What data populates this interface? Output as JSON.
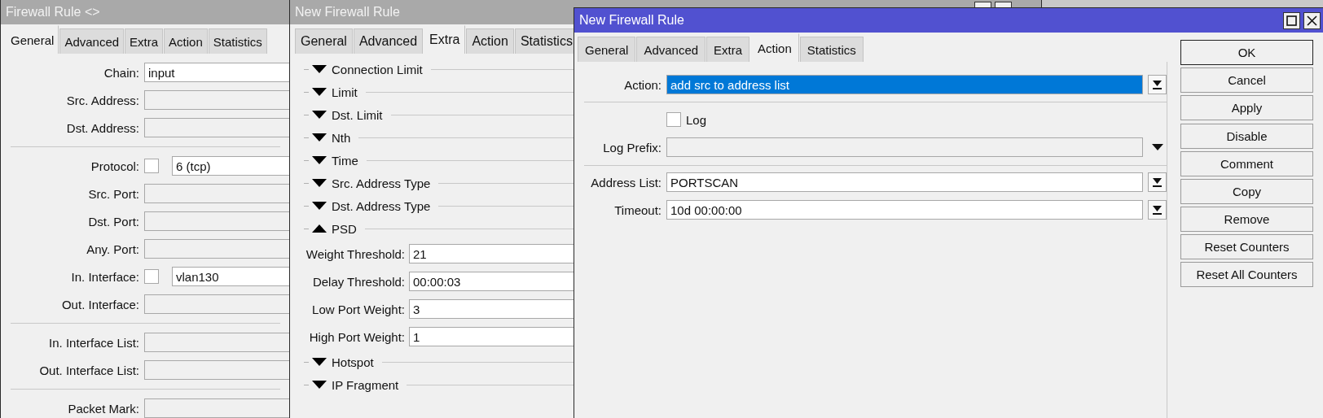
{
  "rule_window": {
    "title": "Firewall Rule <>",
    "active": false,
    "tabs": [
      {
        "label": "General",
        "selected": true
      },
      {
        "label": "Advanced",
        "selected": false
      },
      {
        "label": "Extra",
        "selected": false
      },
      {
        "label": "Action",
        "selected": false
      },
      {
        "label": "Statistics",
        "selected": false
      }
    ],
    "sections": [
      {
        "fields": [
          {
            "kind": "field",
            "label": "Chain:",
            "value": "input"
          },
          {
            "kind": "field",
            "label": "Src. Address:"
          },
          {
            "kind": "field",
            "label": "Dst. Address:"
          }
        ]
      },
      {
        "fields": [
          {
            "kind": "check_field",
            "label": "Protocol:",
            "checked": false,
            "value": "6 (tcp)"
          },
          {
            "kind": "field",
            "label": "Src. Port:"
          },
          {
            "kind": "field",
            "label": "Dst. Port:"
          },
          {
            "kind": "field",
            "label": "Any. Port:"
          },
          {
            "kind": "check_field",
            "label": "In. Interface:",
            "checked": false,
            "value": "vlan130"
          },
          {
            "kind": "field",
            "label": "Out. Interface:"
          }
        ]
      },
      {
        "fields": [
          {
            "kind": "field",
            "label": "In. Interface List:"
          },
          {
            "kind": "field",
            "label": "Out. Interface List:"
          }
        ]
      },
      {
        "fields": [
          {
            "kind": "field",
            "label": "Packet Mark:"
          }
        ]
      }
    ]
  },
  "extra_window": {
    "title": "New Firewall Rule",
    "active": false,
    "tabs": [
      {
        "label": "General",
        "selected": false
      },
      {
        "label": "Advanced",
        "selected": false
      },
      {
        "label": "Extra",
        "selected": true
      },
      {
        "label": "Action",
        "selected": false
      },
      {
        "label": "Statistics",
        "selected": false
      }
    ],
    "sections": [
      {
        "label": "Connection Limit",
        "expanded": false
      },
      {
        "label": "Limit",
        "expanded": false
      },
      {
        "label": "Dst. Limit",
        "expanded": false
      },
      {
        "label": "Nth",
        "expanded": false
      },
      {
        "label": "Time",
        "expanded": false
      },
      {
        "label": "Src. Address Type",
        "expanded": false
      },
      {
        "label": "Dst. Address Type",
        "expanded": false
      },
      {
        "label": "PSD",
        "expanded": true,
        "fields": [
          {
            "label": "Weight Threshold:",
            "value": "21"
          },
          {
            "label": "Delay Threshold:",
            "value": "00:00:03"
          },
          {
            "label": "Low Port Weight:",
            "value": "3"
          },
          {
            "label": "High Port Weight:",
            "value": "1"
          }
        ]
      },
      {
        "label": "Hotspot",
        "expanded": false
      },
      {
        "label": "IP Fragment",
        "expanded": false
      }
    ]
  },
  "action_window": {
    "title": "New Firewall Rule",
    "active": true,
    "tabs": [
      {
        "label": "General",
        "selected": false
      },
      {
        "label": "Advanced",
        "selected": false
      },
      {
        "label": "Extra",
        "selected": false
      },
      {
        "label": "Action",
        "selected": true
      },
      {
        "label": "Statistics",
        "selected": false
      }
    ],
    "action": {
      "label": "Action:",
      "value": "add src to address list",
      "selected": true
    },
    "log": {
      "label": "Log",
      "checked": false
    },
    "log_prefix": {
      "label": "Log Prefix:"
    },
    "address_list": {
      "label": "Address List:",
      "value": "PORTSCAN"
    },
    "timeout": {
      "label": "Timeout:",
      "value": "10d 00:00:00"
    },
    "button_groups": [
      [
        {
          "label": "OK",
          "default": true
        },
        {
          "label": "Cancel",
          "default": false
        },
        {
          "label": "Apply",
          "default": false
        }
      ],
      [
        {
          "label": "Disable",
          "default": false
        },
        {
          "label": "Comment",
          "default": false
        },
        {
          "label": "Copy",
          "default": false
        },
        {
          "label": "Remove",
          "default": false
        },
        {
          "label": "Reset Counters",
          "default": false
        },
        {
          "label": "Reset All Counters",
          "default": false
        }
      ]
    ]
  }
}
